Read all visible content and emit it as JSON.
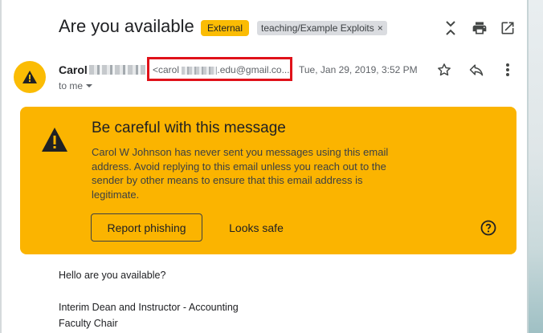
{
  "header": {
    "subject": "Are you available",
    "external_chip": "External",
    "label_chip": "teaching/Example Exploits",
    "label_remove": "×"
  },
  "icons": {
    "expand": "expand-collapse-icon",
    "print": "print-icon",
    "popout": "open-in-new-window-icon",
    "star": "star-icon",
    "reply": "reply-icon",
    "more": "more-vert-icon",
    "avatar": "warning-icon",
    "help": "help-icon"
  },
  "sender": {
    "name": "Carol",
    "email_prefix": "<carol",
    "email_suffix": ".edu@gmail.co...",
    "date": "Tue, Jan 29, 2019, 3:52 PM",
    "recipient": "to me"
  },
  "banner": {
    "title": "Be careful with this message",
    "body": "Carol W Johnson has never sent you messages using this email address. Avoid replying to this email unless you reach out to the sender by other means to ensure that this email address is legitimate.",
    "report_button": "Report phishing",
    "safe_button": "Looks safe"
  },
  "message": {
    "greeting": "Hello are you available?",
    "signature_title": "Interim Dean and Instructor - Accounting",
    "signature_role": "Faculty Chair"
  },
  "colors": {
    "warning": "#fbb400",
    "highlight_box": "#e0121a",
    "label_chip": "#dadce0"
  }
}
